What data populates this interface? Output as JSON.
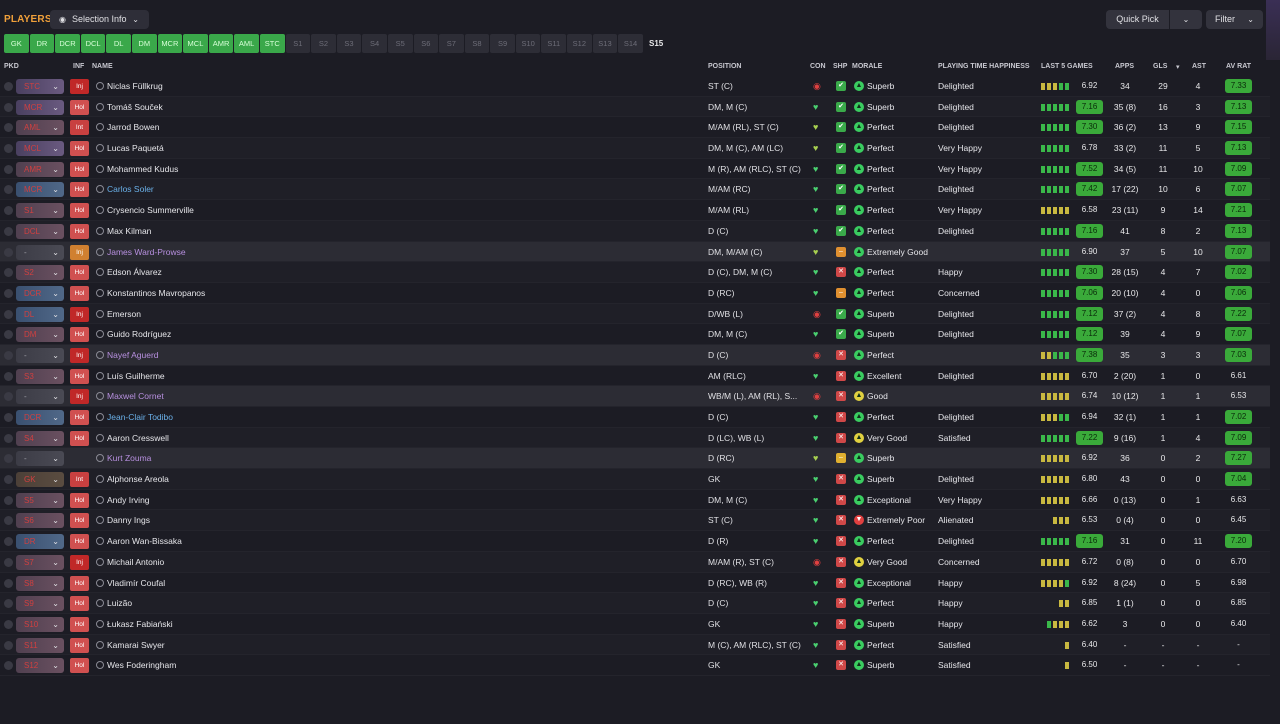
{
  "header": {
    "title": "PLAYERS",
    "selection_info": "Selection Info",
    "quick_pick": "Quick Pick",
    "filter": "Filter"
  },
  "position_tabs": [
    {
      "label": "GK",
      "filled": true
    },
    {
      "label": "DR",
      "filled": true
    },
    {
      "label": "DCR",
      "filled": true
    },
    {
      "label": "DCL",
      "filled": true
    },
    {
      "label": "DL",
      "filled": true
    },
    {
      "label": "DM",
      "filled": true
    },
    {
      "label": "MCR",
      "filled": true
    },
    {
      "label": "MCL",
      "filled": true
    },
    {
      "label": "AMR",
      "filled": true
    },
    {
      "label": "AML",
      "filled": true
    },
    {
      "label": "STC",
      "filled": true
    },
    {
      "label": "S1",
      "filled": false
    },
    {
      "label": "S2",
      "filled": false
    },
    {
      "label": "S3",
      "filled": false
    },
    {
      "label": "S4",
      "filled": false
    },
    {
      "label": "S5",
      "filled": false
    },
    {
      "label": "S6",
      "filled": false
    },
    {
      "label": "S7",
      "filled": false
    },
    {
      "label": "S8",
      "filled": false
    },
    {
      "label": "S9",
      "filled": false
    },
    {
      "label": "S10",
      "filled": false
    },
    {
      "label": "S11",
      "filled": false
    },
    {
      "label": "S12",
      "filled": false
    },
    {
      "label": "S13",
      "filled": false
    },
    {
      "label": "S14",
      "filled": false
    },
    {
      "label": "S15",
      "filled": false,
      "active": true
    }
  ],
  "columns": {
    "pkd": "PKD",
    "inf": "INF",
    "name": "NAME",
    "position": "POSITION",
    "con": "CON",
    "shp": "SHP",
    "morale": "MORALE",
    "pth": "PLAYING TIME HAPPINESS",
    "last5": "LAST 5 GAMES",
    "apps": "APPS",
    "gls": "GLS",
    "ast": "AST",
    "avrat": "AV RAT"
  },
  "players": [
    {
      "pkd": "STC",
      "pkd_style": "purple",
      "inf": "Inj",
      "inf_style": "inj",
      "name": "Niclas Füllkrug",
      "name_style": "",
      "pos": "ST (C)",
      "con": "dot",
      "shp": "g",
      "mor_ic": "g",
      "morale": "Superb",
      "pth": "Delighted",
      "avg": "6.92",
      "avg_hi": false,
      "last5": [
        "y",
        "y",
        "y",
        "g",
        "g"
      ],
      "apps": "34",
      "gls": "29",
      "ast": "4",
      "avrat": "7.33",
      "avrat_hi": true
    },
    {
      "pkd": "MCR",
      "pkd_style": "purple",
      "inf": "Hol",
      "inf_style": "hol",
      "name": "Tomáš Souček",
      "name_style": "",
      "pos": "DM, M (C)",
      "con": "heart",
      "shp": "g",
      "mor_ic": "g",
      "morale": "Superb",
      "pth": "Delighted",
      "avg": "7.16",
      "avg_hi": true,
      "last5": [
        "g",
        "g",
        "g",
        "g",
        "g"
      ],
      "apps": "35 (8)",
      "gls": "16",
      "ast": "3",
      "avrat": "7.13",
      "avrat_hi": true
    },
    {
      "pkd": "AML",
      "pkd_style": "red",
      "inf": "Int",
      "inf_style": "int",
      "name": "Jarrod Bowen",
      "name_style": "",
      "pos": "M/AM (RL), ST (C)",
      "con": "heart-y",
      "shp": "g",
      "mor_ic": "g",
      "morale": "Perfect",
      "pth": "Delighted",
      "avg": "7.30",
      "avg_hi": true,
      "last5": [
        "g",
        "g",
        "g",
        "g",
        "g"
      ],
      "apps": "36 (2)",
      "gls": "13",
      "ast": "9",
      "avrat": "7.15",
      "avrat_hi": true
    },
    {
      "pkd": "MCL",
      "pkd_style": "purple",
      "inf": "Hol",
      "inf_style": "hol",
      "name": "Lucas Paquetá",
      "name_style": "",
      "pos": "DM, M (C), AM (LC)",
      "con": "heart-y",
      "shp": "g",
      "mor_ic": "g",
      "morale": "Perfect",
      "pth": "Very Happy",
      "avg": "6.78",
      "avg_hi": false,
      "last5": [
        "g",
        "g",
        "g",
        "g",
        "g"
      ],
      "apps": "33 (2)",
      "gls": "11",
      "ast": "5",
      "avrat": "7.13",
      "avrat_hi": true
    },
    {
      "pkd": "AMR",
      "pkd_style": "red",
      "inf": "Hol",
      "inf_style": "hol",
      "name": "Mohammed Kudus",
      "name_style": "",
      "pos": "M (R), AM (RLC), ST (C)",
      "con": "heart",
      "shp": "g",
      "mor_ic": "g",
      "morale": "Perfect",
      "pth": "Very Happy",
      "avg": "7.52",
      "avg_hi": true,
      "last5": [
        "g",
        "g",
        "g",
        "g",
        "g"
      ],
      "apps": "34 (5)",
      "gls": "11",
      "ast": "10",
      "avrat": "7.09",
      "avrat_hi": true
    },
    {
      "pkd": "MCR",
      "pkd_style": "blue",
      "inf": "Hol",
      "inf_style": "hol",
      "name": "Carlos Soler",
      "name_style": "blue",
      "pos": "M/AM (RC)",
      "con": "heart",
      "shp": "g",
      "mor_ic": "g",
      "morale": "Perfect",
      "pth": "Delighted",
      "avg": "7.42",
      "avg_hi": true,
      "last5": [
        "g",
        "g",
        "g",
        "g",
        "g"
      ],
      "apps": "17 (22)",
      "gls": "10",
      "ast": "6",
      "avrat": "7.07",
      "avrat_hi": true
    },
    {
      "pkd": "S1",
      "pkd_style": "red",
      "inf": "Hol",
      "inf_style": "hol",
      "name": "Crysencio Summerville",
      "name_style": "",
      "pos": "M/AM (RL)",
      "con": "heart",
      "shp": "g",
      "mor_ic": "g",
      "morale": "Perfect",
      "pth": "Very Happy",
      "avg": "6.58",
      "avg_hi": false,
      "last5": [
        "y",
        "y",
        "y",
        "y",
        "y"
      ],
      "apps": "23 (11)",
      "gls": "9",
      "ast": "14",
      "avrat": "7.21",
      "avrat_hi": true
    },
    {
      "pkd": "DCL",
      "pkd_style": "red",
      "inf": "Hol",
      "inf_style": "hol",
      "name": "Max Kilman",
      "name_style": "",
      "pos": "D (C)",
      "con": "heart",
      "shp": "g",
      "mor_ic": "g",
      "morale": "Perfect",
      "pth": "Delighted",
      "avg": "7.16",
      "avg_hi": true,
      "last5": [
        "g",
        "g",
        "g",
        "g",
        "g"
      ],
      "apps": "41",
      "gls": "8",
      "ast": "2",
      "avrat": "7.13",
      "avrat_hi": true
    },
    {
      "pkd": "-",
      "pkd_style": "gray",
      "inf": "Inj",
      "inf_style": "orange",
      "name": "James Ward-Prowse",
      "name_style": "purple",
      "pos": "DM, M/AM (C)",
      "con": "heart-y",
      "shp": "o",
      "mor_ic": "g",
      "morale": "Extremely Good",
      "pth": "",
      "avg": "6.90",
      "avg_hi": false,
      "last5": [
        "g",
        "g",
        "g",
        "g",
        "g"
      ],
      "apps": "37",
      "gls": "5",
      "ast": "10",
      "avrat": "7.07",
      "avrat_hi": true,
      "injured_row": true
    },
    {
      "pkd": "S2",
      "pkd_style": "red",
      "inf": "Hol",
      "inf_style": "hol",
      "name": "Edson Álvarez",
      "name_style": "",
      "pos": "D (C), DM, M (C)",
      "con": "heart",
      "shp": "r",
      "mor_ic": "g",
      "morale": "Perfect",
      "pth": "Happy",
      "avg": "7.30",
      "avg_hi": true,
      "last5": [
        "g",
        "g",
        "g",
        "g",
        "g"
      ],
      "apps": "28 (15)",
      "gls": "4",
      "ast": "7",
      "avrat": "7.02",
      "avrat_hi": true
    },
    {
      "pkd": "DCR",
      "pkd_style": "blue",
      "inf": "Hol",
      "inf_style": "hol",
      "name": "Konstantinos Mavropanos",
      "name_style": "",
      "pos": "D (RC)",
      "con": "heart",
      "shp": "o",
      "mor_ic": "g",
      "morale": "Perfect",
      "pth": "Concerned",
      "avg": "7.06",
      "avg_hi": true,
      "last5": [
        "g",
        "g",
        "g",
        "g",
        "g"
      ],
      "apps": "20 (10)",
      "gls": "4",
      "ast": "0",
      "avrat": "7.06",
      "avrat_hi": true
    },
    {
      "pkd": "DL",
      "pkd_style": "blue",
      "inf": "Inj",
      "inf_style": "inj",
      "name": "Emerson",
      "name_style": "",
      "pos": "D/WB (L)",
      "con": "dot",
      "shp": "g",
      "mor_ic": "g",
      "morale": "Superb",
      "pth": "Delighted",
      "avg": "7.12",
      "avg_hi": true,
      "last5": [
        "g",
        "g",
        "g",
        "g",
        "g"
      ],
      "apps": "37 (2)",
      "gls": "4",
      "ast": "8",
      "avrat": "7.22",
      "avrat_hi": true
    },
    {
      "pkd": "DM",
      "pkd_style": "red",
      "inf": "Hol",
      "inf_style": "hol",
      "name": "Guido Rodríguez",
      "name_style": "",
      "pos": "DM, M (C)",
      "con": "heart",
      "shp": "g",
      "mor_ic": "g",
      "morale": "Superb",
      "pth": "Delighted",
      "avg": "7.12",
      "avg_hi": true,
      "last5": [
        "g",
        "g",
        "g",
        "g",
        "g"
      ],
      "apps": "39",
      "gls": "4",
      "ast": "9",
      "avrat": "7.07",
      "avrat_hi": true
    },
    {
      "pkd": "-",
      "pkd_style": "gray",
      "inf": "Inj",
      "inf_style": "inj",
      "name": "Nayef Aguerd",
      "name_style": "purple",
      "pos": "D (C)",
      "con": "dot",
      "shp": "r",
      "mor_ic": "g",
      "morale": "Perfect",
      "pth": "",
      "avg": "7.38",
      "avg_hi": true,
      "last5": [
        "y",
        "y",
        "g",
        "g",
        "g"
      ],
      "apps": "35",
      "gls": "3",
      "ast": "3",
      "avrat": "7.03",
      "avrat_hi": true,
      "injured_row": true
    },
    {
      "pkd": "S3",
      "pkd_style": "red",
      "inf": "Hol",
      "inf_style": "hol",
      "name": "Luís Guilherme",
      "name_style": "",
      "pos": "AM (RLC)",
      "con": "heart",
      "shp": "r",
      "mor_ic": "g",
      "morale": "Excellent",
      "pth": "Delighted",
      "avg": "6.70",
      "avg_hi": false,
      "last5": [
        "y",
        "y",
        "y",
        "y",
        "y"
      ],
      "apps": "2 (20)",
      "gls": "1",
      "ast": "0",
      "avrat": "6.61",
      "avrat_hi": false
    },
    {
      "pkd": "-",
      "pkd_style": "gray",
      "inf": "Inj",
      "inf_style": "inj",
      "name": "Maxwel Cornet",
      "name_style": "purple",
      "pos": "WB/M (L), AM (RL), S...",
      "con": "dot",
      "shp": "r",
      "mor_ic": "y",
      "morale": "Good",
      "pth": "",
      "avg": "6.74",
      "avg_hi": false,
      "last5": [
        "y",
        "y",
        "y",
        "y",
        "y"
      ],
      "apps": "10 (12)",
      "gls": "1",
      "ast": "1",
      "avrat": "6.53",
      "avrat_hi": false,
      "injured_row": true
    },
    {
      "pkd": "DCR",
      "pkd_style": "blue",
      "inf": "Hol",
      "inf_style": "hol",
      "name": "Jean-Clair Todibo",
      "name_style": "blue",
      "pos": "D (C)",
      "con": "heart",
      "shp": "r",
      "mor_ic": "g",
      "morale": "Perfect",
      "pth": "Delighted",
      "avg": "6.94",
      "avg_hi": false,
      "last5": [
        "y",
        "y",
        "y",
        "g",
        "g"
      ],
      "apps": "32 (1)",
      "gls": "1",
      "ast": "1",
      "avrat": "7.02",
      "avrat_hi": true
    },
    {
      "pkd": "S4",
      "pkd_style": "red",
      "inf": "Hol",
      "inf_style": "hol",
      "name": "Aaron Cresswell",
      "name_style": "",
      "pos": "D (LC), WB (L)",
      "con": "heart",
      "shp": "r",
      "mor_ic": "y",
      "morale": "Very Good",
      "pth": "Satisfied",
      "avg": "7.22",
      "avg_hi": true,
      "last5": [
        "g",
        "g",
        "g",
        "g",
        "g"
      ],
      "apps": "9 (16)",
      "gls": "1",
      "ast": "4",
      "avrat": "7.09",
      "avrat_hi": true
    },
    {
      "pkd": "-",
      "pkd_style": "gray",
      "inf": "",
      "inf_style": "",
      "name": "Kurt Zouma",
      "name_style": "purple",
      "pos": "D (RC)",
      "con": "heart-y",
      "shp": "y",
      "mor_ic": "g",
      "morale": "Superb",
      "pth": "",
      "avg": "6.92",
      "avg_hi": false,
      "last5": [
        "y",
        "y",
        "y",
        "y",
        "y"
      ],
      "apps": "36",
      "gls": "0",
      "ast": "2",
      "avrat": "7.27",
      "avrat_hi": true,
      "injured_row": true
    },
    {
      "pkd": "GK",
      "pkd_style": "brown",
      "inf": "Int",
      "inf_style": "int",
      "name": "Alphonse Areola",
      "name_style": "",
      "pos": "GK",
      "con": "heart",
      "shp": "r",
      "mor_ic": "g",
      "morale": "Superb",
      "pth": "Delighted",
      "avg": "6.80",
      "avg_hi": false,
      "last5": [
        "y",
        "y",
        "y",
        "y",
        "y"
      ],
      "apps": "43",
      "gls": "0",
      "ast": "0",
      "avrat": "7.04",
      "avrat_hi": true
    },
    {
      "pkd": "S5",
      "pkd_style": "red",
      "inf": "Hol",
      "inf_style": "hol",
      "name": "Andy Irving",
      "name_style": "",
      "pos": "DM, M (C)",
      "con": "heart",
      "shp": "r",
      "mor_ic": "g",
      "morale": "Exceptional",
      "pth": "Very Happy",
      "avg": "6.66",
      "avg_hi": false,
      "last5": [
        "y",
        "y",
        "y",
        "y",
        "y"
      ],
      "apps": "0 (13)",
      "gls": "0",
      "ast": "1",
      "avrat": "6.63",
      "avrat_hi": false
    },
    {
      "pkd": "S6",
      "pkd_style": "red",
      "inf": "Hol",
      "inf_style": "hol",
      "name": "Danny Ings",
      "name_style": "",
      "pos": "ST (C)",
      "con": "heart",
      "shp": "r",
      "mor_ic": "r",
      "morale": "Extremely Poor",
      "pth": "Alienated",
      "avg": "6.53",
      "avg_hi": false,
      "last5": [
        "",
        "",
        "y",
        "y",
        "y"
      ],
      "apps": "0 (4)",
      "gls": "0",
      "ast": "0",
      "avrat": "6.45",
      "avrat_hi": false
    },
    {
      "pkd": "DR",
      "pkd_style": "blue",
      "inf": "Hol",
      "inf_style": "hol",
      "name": "Aaron Wan-Bissaka",
      "name_style": "",
      "pos": "D (R)",
      "con": "heart",
      "shp": "r",
      "mor_ic": "g",
      "morale": "Perfect",
      "pth": "Delighted",
      "avg": "7.16",
      "avg_hi": true,
      "last5": [
        "g",
        "g",
        "g",
        "g",
        "g"
      ],
      "apps": "31",
      "gls": "0",
      "ast": "11",
      "avrat": "7.20",
      "avrat_hi": true
    },
    {
      "pkd": "S7",
      "pkd_style": "red",
      "inf": "Inj",
      "inf_style": "inj",
      "name": "Michail Antonio",
      "name_style": "",
      "pos": "M/AM (R), ST (C)",
      "con": "dot",
      "shp": "r",
      "mor_ic": "y",
      "morale": "Very Good",
      "pth": "Concerned",
      "avg": "6.72",
      "avg_hi": false,
      "last5": [
        "y",
        "y",
        "y",
        "y",
        "y"
      ],
      "apps": "0 (8)",
      "gls": "0",
      "ast": "0",
      "avrat": "6.70",
      "avrat_hi": false
    },
    {
      "pkd": "S8",
      "pkd_style": "red",
      "inf": "Hol",
      "inf_style": "hol",
      "name": "Vladimír Coufal",
      "name_style": "",
      "pos": "D (RC), WB (R)",
      "con": "heart",
      "shp": "r",
      "mor_ic": "g",
      "morale": "Exceptional",
      "pth": "Happy",
      "avg": "6.92",
      "avg_hi": false,
      "last5": [
        "y",
        "y",
        "y",
        "y",
        "g"
      ],
      "apps": "8 (24)",
      "gls": "0",
      "ast": "5",
      "avrat": "6.98",
      "avrat_hi": false
    },
    {
      "pkd": "S9",
      "pkd_style": "red",
      "inf": "Hol",
      "inf_style": "hol",
      "name": "Luizão",
      "name_style": "",
      "pos": "D (C)",
      "con": "heart",
      "shp": "r",
      "mor_ic": "g",
      "morale": "Perfect",
      "pth": "Happy",
      "avg": "6.85",
      "avg_hi": false,
      "last5": [
        "",
        "",
        "",
        "y",
        "y"
      ],
      "apps": "1 (1)",
      "gls": "0",
      "ast": "0",
      "avrat": "6.85",
      "avrat_hi": false
    },
    {
      "pkd": "S10",
      "pkd_style": "red",
      "inf": "Hol",
      "inf_style": "hol",
      "name": "Łukasz Fabiański",
      "name_style": "",
      "pos": "GK",
      "con": "heart",
      "shp": "r",
      "mor_ic": "g",
      "morale": "Superb",
      "pth": "Happy",
      "avg": "6.62",
      "avg_hi": false,
      "last5": [
        "",
        "g",
        "y",
        "y",
        "y"
      ],
      "apps": "3",
      "gls": "0",
      "ast": "0",
      "avrat": "6.40",
      "avrat_hi": false
    },
    {
      "pkd": "S11",
      "pkd_style": "red",
      "inf": "Hol",
      "inf_style": "hol",
      "name": "Kamarai Swyer",
      "name_style": "",
      "pos": "M (C), AM (RLC), ST (C)",
      "con": "heart",
      "shp": "r",
      "mor_ic": "g",
      "morale": "Perfect",
      "pth": "Satisfied",
      "avg": "6.40",
      "avg_hi": false,
      "last5": [
        "",
        "",
        "",
        "",
        "y"
      ],
      "apps": "-",
      "gls": "-",
      "ast": "-",
      "avrat": "-",
      "avrat_hi": false
    },
    {
      "pkd": "S12",
      "pkd_style": "red",
      "inf": "Hol",
      "inf_style": "hol",
      "name": "Wes Foderingham",
      "name_style": "",
      "pos": "GK",
      "con": "heart",
      "shp": "r",
      "mor_ic": "g",
      "morale": "Superb",
      "pth": "Satisfied",
      "avg": "6.50",
      "avg_hi": false,
      "last5": [
        "",
        "",
        "",
        "",
        "y"
      ],
      "apps": "-",
      "gls": "-",
      "ast": "-",
      "avrat": "-",
      "avrat_hi": false
    }
  ],
  "colors": {
    "accent": "#f0a03a",
    "rating_green": "#3aaa3a",
    "tab_green": "#3aa84a"
  }
}
